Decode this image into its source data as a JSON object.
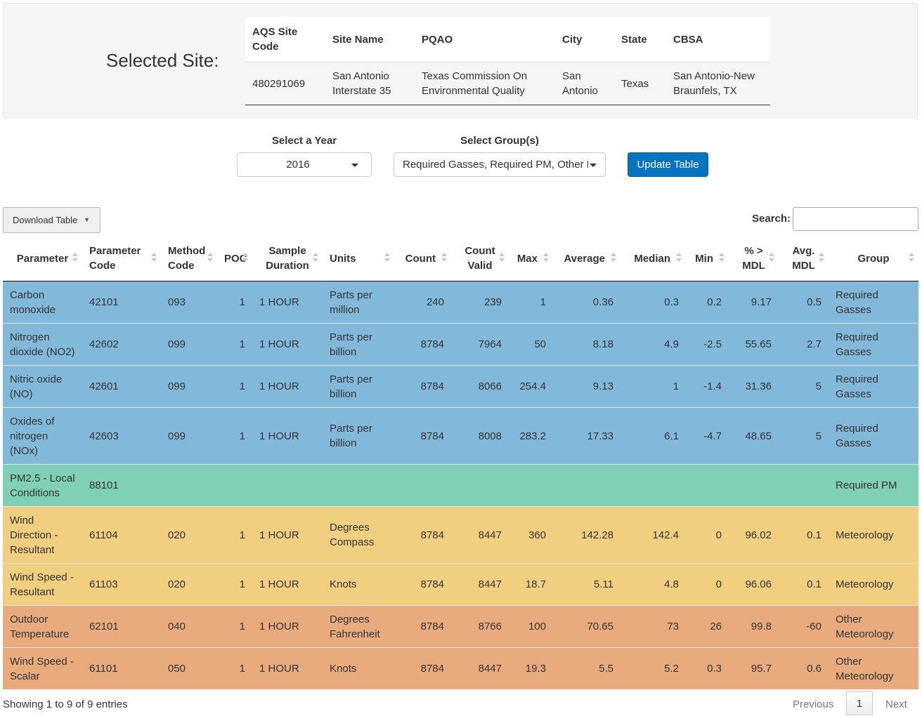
{
  "selected_site": {
    "label": "Selected Site:",
    "headers": [
      "AQS Site Code",
      "Site Name",
      "PQAO",
      "City",
      "State",
      "CBSA"
    ],
    "row": [
      "480291069",
      "San Antonio Interstate 35",
      "Texas Commission On Environmental Quality",
      "San Antonio",
      "Texas",
      "San Antonio-New Braunfels, TX"
    ]
  },
  "controls": {
    "year_label": "Select a Year",
    "year_value": "2016",
    "group_label": "Select Group(s)",
    "group_value": "Required Gasses, Required PM, Other Meteorology, Meteorology",
    "update_button": "Update Table",
    "download_button": "Download Table",
    "download_caret": "▼",
    "search_label": "Search:",
    "search_value": ""
  },
  "table": {
    "headers": [
      "Parameter",
      "Parameter Code",
      "Method Code",
      "POC",
      "Sample Duration",
      "Units",
      "Count",
      "Count Valid",
      "Max",
      "Average",
      "Median",
      "Min",
      "% > MDL",
      "Avg. MDL",
      "Group"
    ],
    "rows": [
      {
        "color": "blue",
        "cells": [
          "Carbon monoxide",
          "42101",
          "093",
          "1",
          "1 HOUR",
          "Parts per million",
          "240",
          "239",
          "1",
          "0.36",
          "0.3",
          "0.2",
          "9.17",
          "0.5",
          "Required Gasses"
        ]
      },
      {
        "color": "blue",
        "cells": [
          "Nitrogen dioxide (NO2)",
          "42602",
          "099",
          "1",
          "1 HOUR",
          "Parts per billion",
          "8784",
          "7964",
          "50",
          "8.18",
          "4.9",
          "-2.5",
          "55.65",
          "2.7",
          "Required Gasses"
        ]
      },
      {
        "color": "blue",
        "cells": [
          "Nitric oxide (NO)",
          "42601",
          "099",
          "1",
          "1 HOUR",
          "Parts per billion",
          "8784",
          "8066",
          "254.4",
          "9.13",
          "1",
          "-1.4",
          "31.36",
          "5",
          "Required Gasses"
        ]
      },
      {
        "color": "blue",
        "cells": [
          "Oxides of nitrogen (NOx)",
          "42603",
          "099",
          "1",
          "1 HOUR",
          "Parts per billion",
          "8784",
          "8008",
          "283.2",
          "17.33",
          "6.1",
          "-4.7",
          "48.65",
          "5",
          "Required Gasses"
        ]
      },
      {
        "color": "green",
        "cells": [
          "PM2.5 - Local Conditions",
          "88101",
          "",
          "",
          "",
          "",
          "",
          "",
          "",
          "",
          "",
          "",
          "",
          "",
          "Required PM"
        ]
      },
      {
        "color": "yellow",
        "cells": [
          "Wind Direction - Resultant",
          "61104",
          "020",
          "1",
          "1 HOUR",
          "Degrees Compass",
          "8784",
          "8447",
          "360",
          "142.28",
          "142.4",
          "0",
          "96.02",
          "0.1",
          "Meteorology"
        ]
      },
      {
        "color": "yellow",
        "cells": [
          "Wind Speed - Resultant",
          "61103",
          "020",
          "1",
          "1 HOUR",
          "Knots",
          "8784",
          "8447",
          "18.7",
          "5.11",
          "4.8",
          "0",
          "96.06",
          "0.1",
          "Meteorology"
        ]
      },
      {
        "color": "orange",
        "cells": [
          "Outdoor Temperature",
          "62101",
          "040",
          "1",
          "1 HOUR",
          "Degrees Fahrenheit",
          "8784",
          "8766",
          "100",
          "70.65",
          "73",
          "26",
          "99.8",
          "-60",
          "Other Meteorology"
        ]
      },
      {
        "color": "orange",
        "cells": [
          "Wind Speed - Scalar",
          "61101",
          "050",
          "1",
          "1 HOUR",
          "Knots",
          "8784",
          "8447",
          "19.3",
          "5.5",
          "5.2",
          "0.3",
          "95.7",
          "0.6",
          "Other Meteorology"
        ]
      }
    ]
  },
  "footer": {
    "info": "Showing 1 to 9 of 9 entries",
    "previous": "Previous",
    "current_page": "1",
    "next": "Next"
  }
}
